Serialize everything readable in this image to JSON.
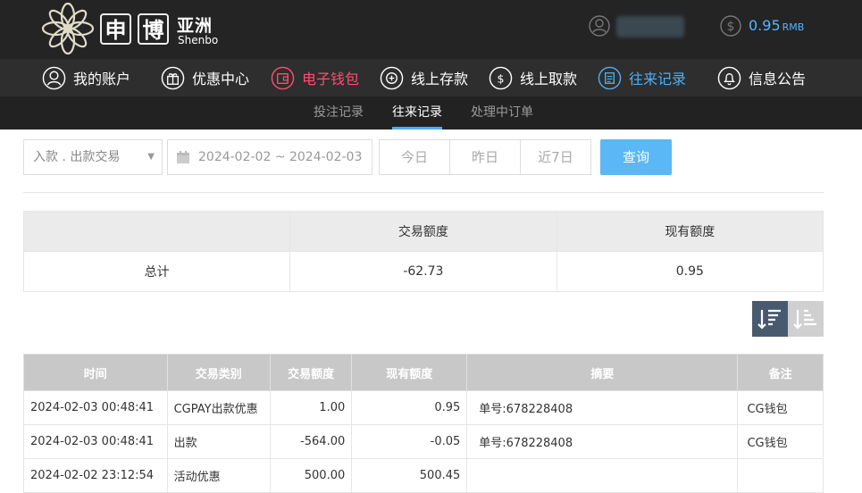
{
  "header": {
    "logo_char1": "申",
    "logo_char2": "博",
    "logo_cn": "亚洲",
    "logo_en": "Shenbo",
    "balance": "0.95",
    "currency": "RMB"
  },
  "main_nav": [
    {
      "label": "我的账户",
      "icon": "user-icon"
    },
    {
      "label": "优惠中心",
      "icon": "gift-icon"
    },
    {
      "label": "电子钱包",
      "icon": "wallet-icon",
      "color": "#ff4d6d"
    },
    {
      "label": "线上存款",
      "icon": "deposit-icon"
    },
    {
      "label": "线上取款",
      "icon": "withdraw-icon"
    },
    {
      "label": "往来记录",
      "icon": "records-icon",
      "color": "#4aaef5"
    },
    {
      "label": "信息公告",
      "icon": "bell-icon"
    }
  ],
  "sub_nav": [
    {
      "label": "投注记录"
    },
    {
      "label": "往来记录",
      "active": true
    },
    {
      "label": "处理中订单"
    }
  ],
  "filters": {
    "type_select": "入款 . 出款交易",
    "date_range": "2024-02-02 ~ 2024-02-03",
    "quick_today": "今日",
    "quick_yesterday": "昨日",
    "quick_7days": "近7日",
    "query": "查询"
  },
  "summary": {
    "col_amount": "交易额度",
    "col_balance": "现有额度",
    "row_label": "总计",
    "amount": "-62.73",
    "balance": "0.95"
  },
  "records": {
    "columns": [
      "时间",
      "交易类别",
      "交易额度",
      "现有额度",
      "摘要",
      "备注"
    ],
    "rows": [
      [
        "2024-02-03 00:48:41",
        "CGPAY出款优惠",
        "1.00",
        "0.95",
        "单号:678228408",
        "CG钱包"
      ],
      [
        "2024-02-03 00:48:41",
        "出款",
        "-564.00",
        "-0.05",
        "单号:678228408",
        "CG钱包"
      ],
      [
        "2024-02-02 23:12:54",
        "活动优惠",
        "500.00",
        "500.45",
        "",
        ""
      ]
    ]
  },
  "colors": {
    "accent": "#4aaef5",
    "active_red": "#ff4d6d",
    "header_bg": "#242424"
  }
}
